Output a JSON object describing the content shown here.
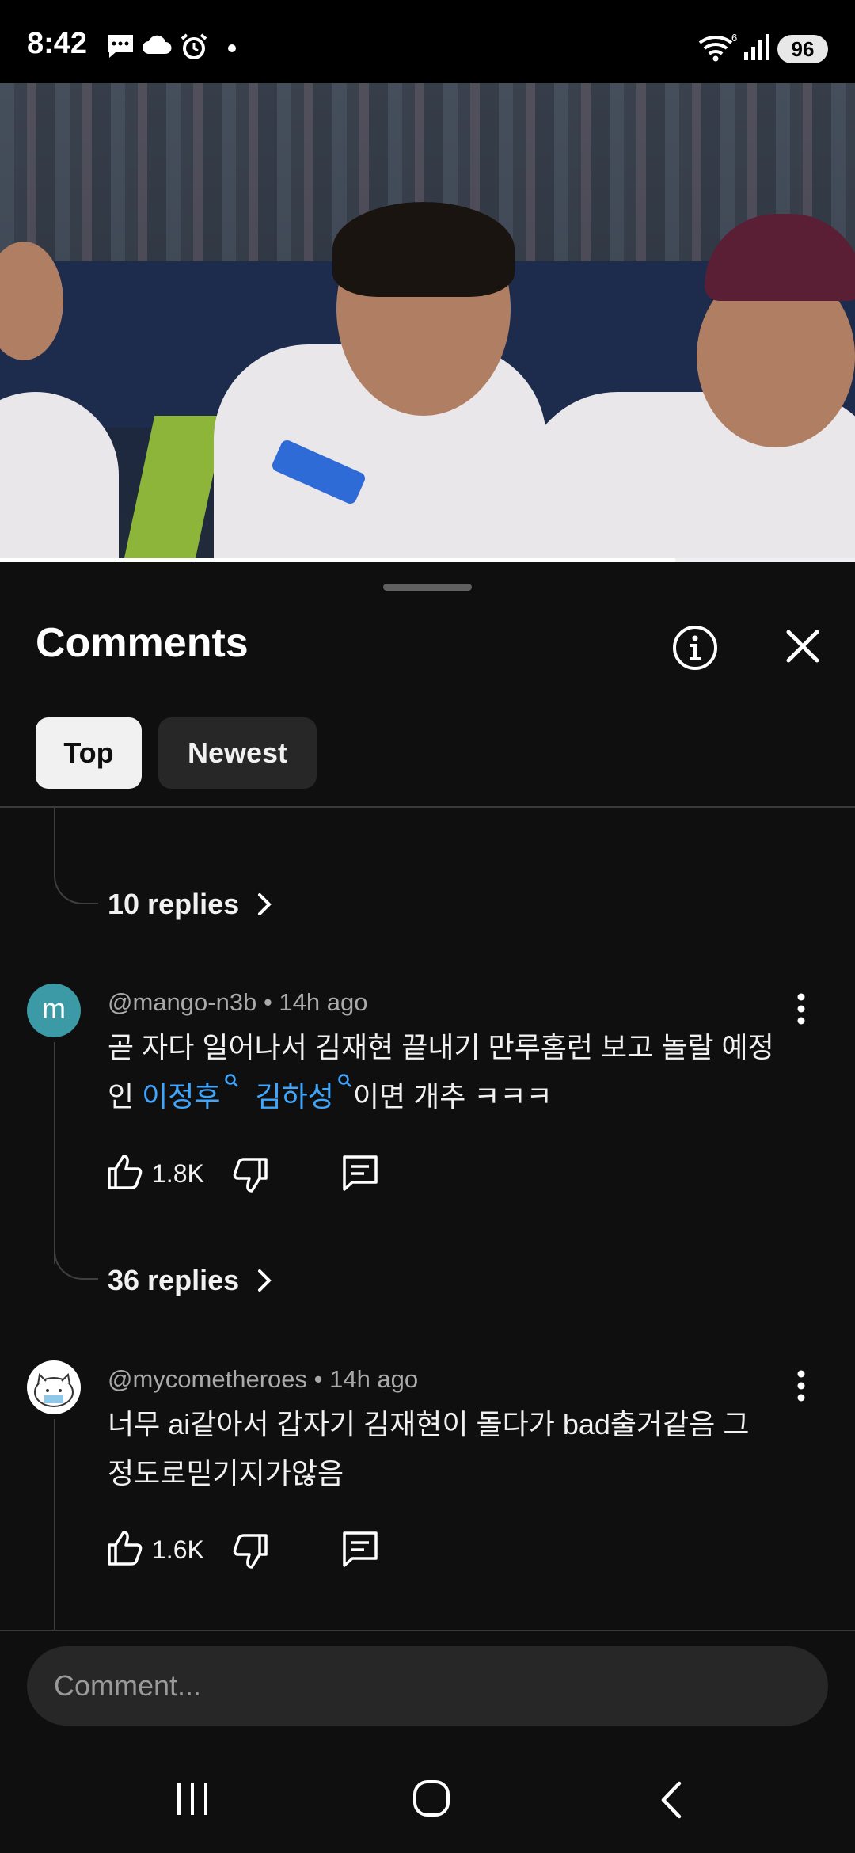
{
  "status_bar": {
    "time": "8:42",
    "battery": "96"
  },
  "video": {
    "progress": 0.79
  },
  "comments_panel": {
    "title": "Comments",
    "chips": [
      {
        "label": "Top",
        "selected": true
      },
      {
        "label": "Newest",
        "selected": false
      }
    ],
    "threads": [
      {
        "replies_label": "10 replies"
      },
      {
        "avatar_letter": "m",
        "author": "@mango-n3b",
        "time": "14h ago",
        "text_line1": "곧 자다 일어나서 김재현 끝내기 만루홈런 보고 놀랄 예정",
        "text_line2_prefix": "인 ",
        "link1": "이정후",
        "link2": "김하성",
        "text_line2_suffix": "이면 개추 ㅋㅋㅋ",
        "likes": "1.8K",
        "replies_label": "36 replies"
      },
      {
        "author": "@mycometheroes",
        "time": "14h ago",
        "text_line1": "너무 ai같아서 갑자기 김재현이 돌다가 bad출거같음 그",
        "text_line2": "정도로믿기지가않음",
        "likes": "1.6K"
      }
    ],
    "input_placeholder": "Comment..."
  },
  "icons": {
    "status": [
      "message-icon",
      "cloud-icon",
      "alarm-icon",
      "dot-icon",
      "wifi-icon",
      "signal-icon"
    ],
    "panel": [
      "info-icon",
      "close-icon",
      "chevron-right-icon",
      "like-icon",
      "dislike-icon",
      "reply-icon",
      "more-vert-icon"
    ],
    "nav": [
      "recents-icon",
      "home-icon",
      "back-icon"
    ]
  },
  "colors": {
    "background": "#0f0f0f",
    "link": "#3ea6ff",
    "chip_selected": "#f1f1f1",
    "chip": "#272727"
  }
}
